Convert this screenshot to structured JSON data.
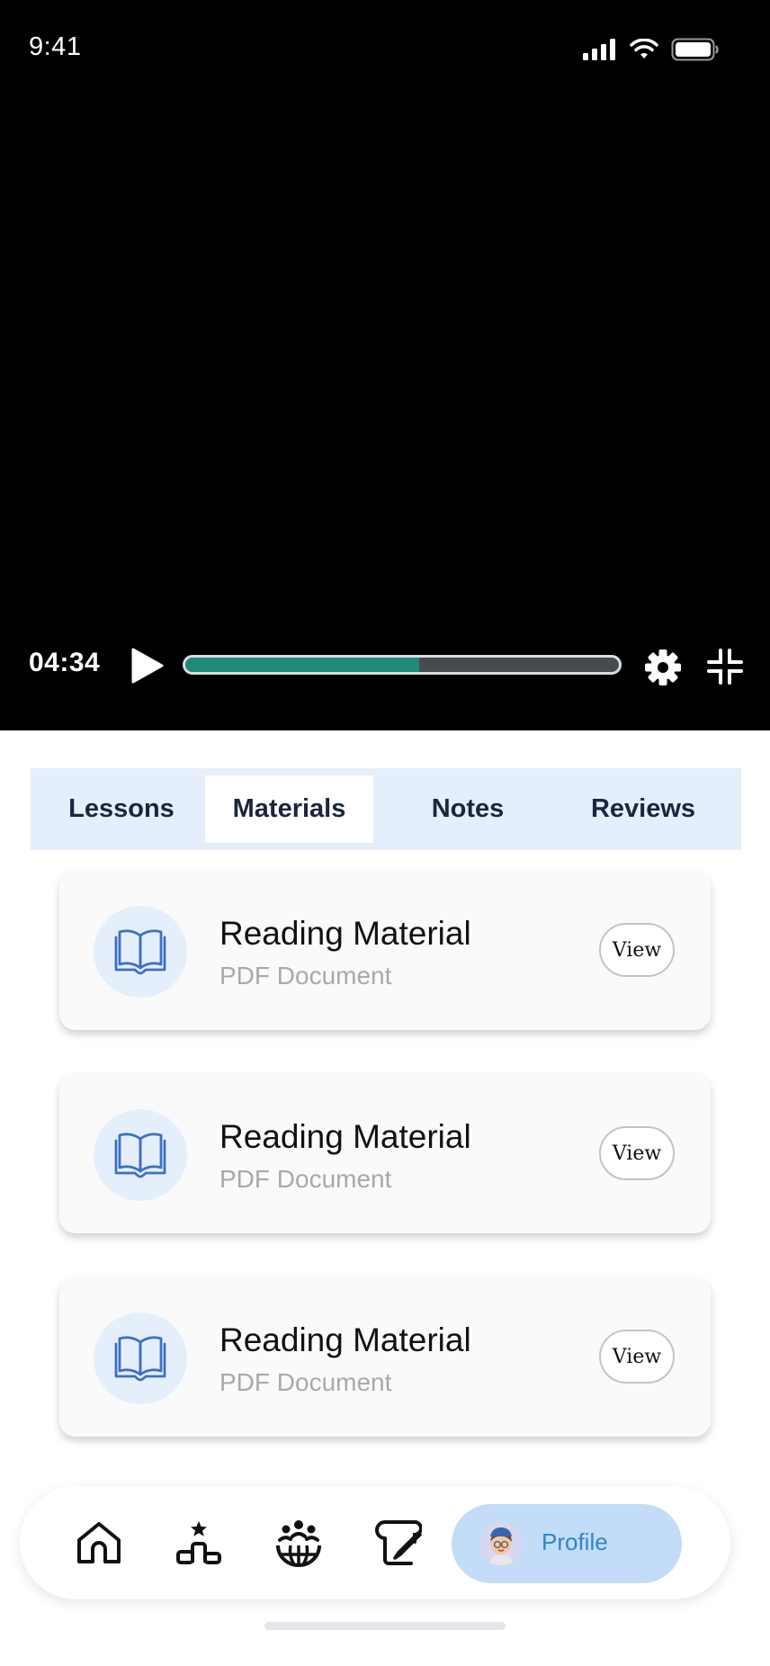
{
  "status_bar": {
    "time": "9:41"
  },
  "player": {
    "current_time": "04:34",
    "progress": 0.54,
    "colors": {
      "progress_fill": "#1f8a7a",
      "progress_track": "#474b4f"
    }
  },
  "tabs": [
    {
      "label": "Lessons",
      "active": false
    },
    {
      "label": "Materials",
      "active": true
    },
    {
      "label": "Notes",
      "active": false
    },
    {
      "label": "Reviews",
      "active": false
    }
  ],
  "materials": [
    {
      "title": "Reading Material",
      "subtitle": "PDF Document",
      "action": "View",
      "icon": "book-icon"
    },
    {
      "title": "Reading Material",
      "subtitle": "PDF Document",
      "action": "View",
      "icon": "book-icon"
    },
    {
      "title": "Reading Material",
      "subtitle": "PDF Document",
      "action": "View",
      "icon": "book-icon"
    }
  ],
  "bottom_nav": {
    "items": [
      "home-icon",
      "leaderboard-icon",
      "community-icon",
      "write-icon"
    ],
    "profile_label": "Profile",
    "colors": {
      "profile_bg": "#c3dcf7",
      "profile_text": "#2f86c8"
    }
  }
}
